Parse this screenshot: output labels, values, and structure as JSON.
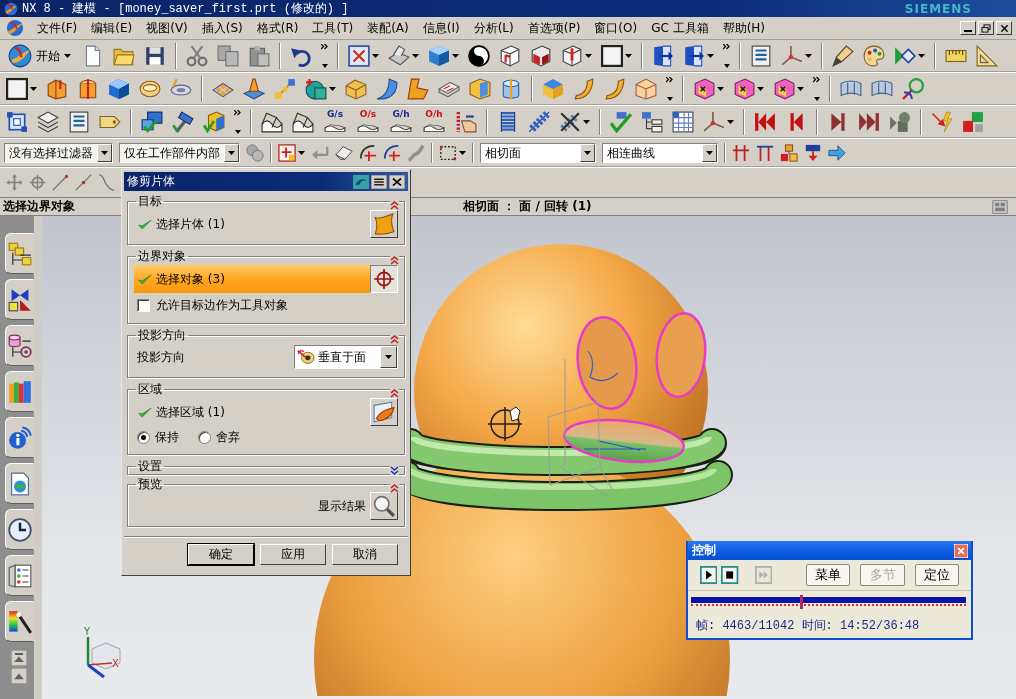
{
  "window": {
    "title": "NX 8 - 建模 - [money_saver_first.prt (修改的) ]",
    "brand": "SIEMENS"
  },
  "menu_bar": {
    "items": [
      "文件(F)",
      "编辑(E)",
      "视图(V)",
      "插入(S)",
      "格式(R)",
      "工具(T)",
      "装配(A)",
      "信息(I)",
      "分析(L)",
      "首选项(P)",
      "窗口(O)",
      "GC 工具箱",
      "帮助(H)"
    ]
  },
  "toolbars": {
    "start_button": "开始",
    "analysis_tools": [
      {
        "label": "G/s",
        "color": "#1a2a8c"
      },
      {
        "label": "O/s",
        "color": "#c81414"
      },
      {
        "label": "G/h",
        "color": "#1a2a8c"
      },
      {
        "label": "O/h",
        "color": "#c81414"
      }
    ]
  },
  "selection_bar": {
    "type_filter": "没有选择过滤器",
    "scope": "仅在工作部件内部",
    "face_rule": "相切面",
    "curve_rule": "相连曲线"
  },
  "cue_line": {
    "prompt": "选择边界对象",
    "status": "相切面 ： 面 / 回转 (1)"
  },
  "dialog": {
    "title": "修剪片体",
    "groups": [
      {
        "title": "目标",
        "expanded": true,
        "rows": [
          {
            "kind": "select",
            "label": "选择片体 (1)",
            "complete": true,
            "active": false
          }
        ]
      },
      {
        "title": "边界对象",
        "expanded": true,
        "rows": [
          {
            "kind": "select",
            "label": "选择对象 (3)",
            "complete": true,
            "active": true
          },
          {
            "kind": "checkbox",
            "label": "允许目标边作为工具对象",
            "checked": false
          }
        ]
      },
      {
        "title": "投影方向",
        "expanded": true,
        "rows": [
          {
            "kind": "dropdown",
            "label": "投影方向",
            "value": "垂直于面"
          }
        ]
      },
      {
        "title": "区域",
        "expanded": true,
        "rows": [
          {
            "kind": "select",
            "label": "选择区域 (1)",
            "complete": true,
            "active": false
          },
          {
            "kind": "radio",
            "options": [
              {
                "label": "保持",
                "selected": true
              },
              {
                "label": "舍弃",
                "selected": false
              }
            ]
          }
        ]
      },
      {
        "title": "设置",
        "expanded": false
      },
      {
        "title": "预览",
        "expanded": true,
        "rows": [
          {
            "kind": "action",
            "label": "显示结果"
          }
        ]
      }
    ],
    "buttons": [
      {
        "label": "确定",
        "default": true
      },
      {
        "label": "应用",
        "default": false
      },
      {
        "label": "取消",
        "default": false
      }
    ]
  },
  "control_panel": {
    "title": "控制",
    "buttons": [
      {
        "kind": "play",
        "disabled": false
      },
      {
        "kind": "stop",
        "disabled": false
      },
      {
        "kind": "step",
        "disabled": true
      },
      {
        "kind": "text",
        "label": "菜单",
        "disabled": false
      },
      {
        "kind": "text",
        "label": "多节",
        "disabled": true
      },
      {
        "kind": "text",
        "label": "定位",
        "disabled": false
      }
    ],
    "level": 0.4,
    "readout": "帧: 4463/11042 时间: 14:52/36:48"
  },
  "graphics": {
    "triad_labels": [
      "Y",
      "X"
    ]
  }
}
